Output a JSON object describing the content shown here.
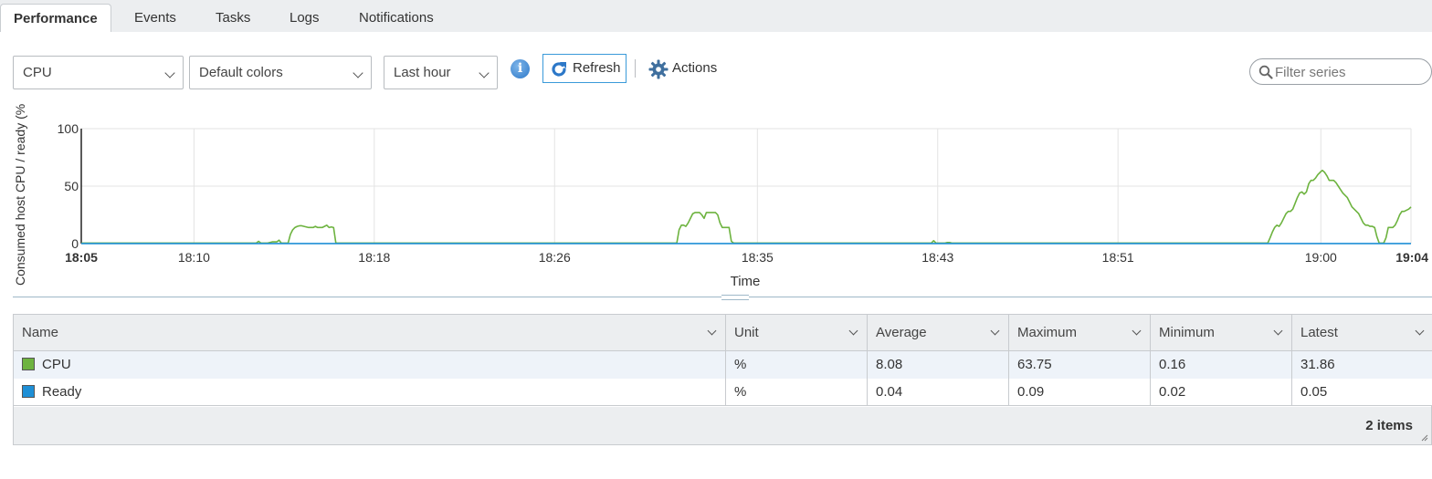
{
  "tabs": [
    {
      "label": "Performance",
      "active": true
    },
    {
      "label": "Events",
      "active": false
    },
    {
      "label": "Tasks",
      "active": false
    },
    {
      "label": "Logs",
      "active": false
    },
    {
      "label": "Notifications",
      "active": false
    }
  ],
  "toolbar": {
    "metric_select": "CPU",
    "color_select": "Default colors",
    "period_select": "Last hour",
    "info_icon": "info-icon",
    "refresh_label": "Refresh",
    "actions_label": "Actions",
    "filter_placeholder": "Filter series"
  },
  "chart_data": {
    "type": "line",
    "title": "",
    "ylabel": "Consumed host CPU / ready (%",
    "xlabel": "Time",
    "ylim": [
      0,
      100
    ],
    "yticks": [
      0,
      50,
      100
    ],
    "x_range": [
      "18:05",
      "19:04"
    ],
    "xticks": [
      {
        "label": "18:05",
        "minute": 0,
        "bold": true
      },
      {
        "label": "18:10",
        "minute": 5
      },
      {
        "label": "18:18",
        "minute": 13
      },
      {
        "label": "18:26",
        "minute": 21
      },
      {
        "label": "18:35",
        "minute": 30
      },
      {
        "label": "18:43",
        "minute": 38
      },
      {
        "label": "18:51",
        "minute": 46
      },
      {
        "label": "19:00",
        "minute": 55
      },
      {
        "label": "19:04",
        "minute": 59,
        "bold": true
      }
    ],
    "grid": true,
    "series": [
      {
        "name": "CPU",
        "color": "#6db33f",
        "values": [
          0.5,
          0.5,
          0.5,
          0.5,
          0.5,
          0.5,
          0.5,
          0.5,
          0.5,
          0.5,
          0.5,
          0.5,
          0.5,
          0.5,
          0.5,
          0.5,
          0.5,
          0.5,
          0.5,
          0.5,
          0.5,
          0.5,
          0.5,
          0.5,
          0.5,
          0.5,
          0.5,
          0.5,
          0.5,
          0.5,
          0.5,
          0.5,
          0.5,
          0.5,
          0.5,
          0.5,
          0.5,
          0.5,
          0.5,
          0.5,
          0.5,
          0.5,
          0.5,
          0.5,
          0.5,
          0.5,
          0.5,
          0.5,
          0.5,
          0.5,
          0.5,
          0.5,
          0.5,
          0.5,
          0.5,
          0.5,
          0.5,
          0.5,
          0.5,
          0.5,
          0.5,
          0.5,
          0.5,
          0.5,
          0.5,
          0.5,
          0.5,
          0.5,
          0.5,
          0.5,
          0.5,
          0.5,
          0.5,
          0.5,
          0.5,
          0.5,
          0.5,
          0.5,
          2,
          0.5,
          0.5,
          0.5,
          0.5,
          1,
          1.5,
          1.5,
          1.5,
          3,
          0.5,
          0.5,
          0.5,
          0.5,
          8,
          12,
          14,
          15,
          15.5,
          15.5,
          15,
          14.5,
          14,
          14,
          14,
          15,
          14,
          14,
          14,
          15,
          16,
          14,
          14.5,
          14,
          0.5,
          0.5,
          0.5,
          0.5,
          0.5,
          0.5,
          0.5,
          0.5,
          0.5,
          0.5,
          0.5,
          0.5,
          0.5,
          0.5,
          0.5,
          0.5,
          0.5,
          0.5,
          0.5,
          0.5,
          0.5,
          0.5,
          0.5,
          0.5,
          0.5,
          0.5,
          0.5,
          0.5,
          0.5,
          0.5,
          0.5,
          0.5,
          0.5,
          0.5,
          0.5,
          0.5,
          0.5,
          0.5,
          0.5,
          0.5,
          0.5,
          0.5,
          0.5,
          0.5,
          0.5,
          0.5,
          0.5,
          0.5,
          0.5,
          0.5,
          0.5,
          0.5,
          0.5,
          0.5,
          0.5,
          0.5,
          0.5,
          0.5,
          0.5,
          0.5,
          0.5,
          0.5,
          0.5,
          0.5,
          0.5,
          0.5,
          0.5,
          0.5,
          0.5,
          0.5,
          0.5,
          0.5,
          0.5,
          0.5,
          0.5,
          0.5,
          0.5,
          0.5,
          0.5,
          0.5,
          0.5,
          0.5,
          0.5,
          0.5,
          0.5,
          0.5,
          0.5,
          0.5,
          0.5,
          0.5,
          0.5,
          0.5,
          0.5,
          0.5,
          0.5,
          0.5,
          0.5,
          0.5,
          0.5,
          0.5,
          0.5,
          0.5,
          0.5,
          0.5,
          0.5,
          0.5,
          0.5,
          0.5,
          0.5,
          0.5,
          0.5,
          0.5,
          0.5,
          0.5,
          0.5,
          0.5,
          0.5,
          0.5,
          0.5,
          0.5,
          0.5,
          0.5,
          0.5,
          0.5,
          0.5,
          0.5,
          0.5,
          0.5,
          0.5,
          0.5,
          0.5,
          0.5,
          0.5,
          0.5,
          0.5,
          0.5,
          0.5,
          0.5,
          0.5,
          0.5,
          0.5,
          0.5,
          0.5,
          0.5,
          0.5,
          0.5,
          0.5,
          0.5,
          0.5,
          0.5,
          0.5,
          12,
          16,
          16,
          15,
          18,
          22,
          26,
          27,
          27,
          27,
          25,
          22,
          27,
          27,
          27,
          27,
          27,
          25,
          18,
          14,
          14,
          14,
          14,
          2,
          0.5,
          0.5,
          0.5,
          0.5,
          0.5,
          0.5,
          0.5,
          0.5,
          0.5,
          0.5,
          0.5,
          0.5,
          0.5,
          0.5,
          0.5,
          0.5,
          0.5,
          0.5,
          0.5,
          0.5,
          0.5,
          0.5,
          0.5,
          0.5,
          0.5,
          0.5,
          0.5,
          0.5,
          0.5,
          0.5,
          0.5,
          0.5,
          0.5,
          0.5,
          0.5,
          0.5,
          0.5,
          0.5,
          0.5,
          0.5,
          0.5,
          0.5,
          0.5,
          0.5,
          0.5,
          0.5,
          0.5,
          0.5,
          0.5,
          0.5,
          0.5,
          0.5,
          0.5,
          0.5,
          0.5,
          0.5,
          0.5,
          0.5,
          0.5,
          0.5,
          0.5,
          0.5,
          0.5,
          0.5,
          0.5,
          0.5,
          0.5,
          0.5,
          0.5,
          0.5,
          0.5,
          0.5,
          0.5,
          0.5,
          0.5,
          0.5,
          0.5,
          0.5,
          0.5,
          0.5,
          0.5,
          0.5,
          0.5,
          0.5,
          0.5,
          0.5,
          0.5,
          0.5,
          2.5,
          0.5,
          0.5,
          0.5,
          0.5,
          0.5,
          1,
          1,
          0.5,
          0.5,
          0.5,
          0.5,
          0.5,
          0.5,
          0.5,
          0.5,
          0.5,
          0.5,
          0.5,
          0.5,
          0.5,
          0.5,
          0.5,
          0.5,
          0.5,
          0.5,
          0.5,
          0.5,
          0.5,
          0.5,
          0.5,
          0.5,
          0.5,
          0.5,
          0.5,
          0.5,
          0.5,
          0.5,
          0.5,
          0.5,
          0.5,
          0.5,
          0.5,
          0.5,
          0.5,
          0.5,
          0.5,
          0.5,
          0.5,
          0.5,
          0.5,
          0.5,
          0.5,
          0.5,
          0.5,
          0.5,
          0.5,
          0.5,
          0.5,
          0.5,
          0.5,
          0.5,
          0.5,
          0.5,
          0.5,
          0.5,
          0.5,
          0.5,
          0.5,
          0.5,
          0.5,
          0.5,
          0.5,
          0.5,
          0.5,
          0.5,
          0.5,
          0.5,
          0.5,
          0.5,
          0.5,
          0.5,
          0.5,
          0.5,
          0.5,
          0.5,
          0.5,
          0.5,
          0.5,
          0.5,
          0.5,
          0.5,
          0.5,
          0.5,
          0.5,
          0.5,
          0.5,
          0.5,
          0.5,
          0.5,
          0.5,
          0.5,
          0.5,
          0.5,
          0.5,
          0.5,
          0.5,
          0.5,
          0.5,
          0.5,
          0.5,
          0.5,
          0.5,
          0.5,
          0.5,
          0.5,
          0.5,
          0.5,
          0.5,
          0.5,
          0.5,
          0.5,
          0.5,
          0.5,
          0.5,
          0.5,
          0.5,
          0.5,
          0.5,
          0.5,
          0.5,
          0.5,
          0.5,
          0.5,
          0.5,
          0.5,
          0.5,
          0.5,
          0.5,
          0.5,
          0.5,
          0.5,
          0.5,
          0.5,
          0.5,
          0.5,
          0.5,
          0.5,
          5,
          10,
          14,
          16,
          15,
          18,
          22,
          26,
          28,
          28,
          30,
          35,
          40,
          44,
          45,
          43,
          45,
          52,
          55,
          55,
          57,
          60,
          62,
          63.75,
          62,
          59,
          55,
          55,
          55,
          53,
          50,
          47,
          44,
          42,
          40,
          36,
          32,
          30,
          28,
          26,
          22,
          18,
          16,
          16,
          15,
          15,
          14,
          6,
          0.5,
          0.5,
          0.5,
          5,
          14,
          14,
          14,
          16,
          20,
          25,
          28,
          28,
          29,
          30,
          31.86
        ]
      },
      {
        "name": "Ready",
        "color": "#1e8fd6",
        "values": [
          0.05,
          0.05,
          0.05,
          0.05,
          0.05,
          0.05,
          0.05,
          0.05,
          0.05,
          0.05,
          0.05,
          0.05,
          0.05,
          0.05,
          0.05,
          0.05,
          0.05,
          0.05,
          0.05,
          0.05,
          0.05,
          0.05,
          0.05,
          0.05,
          0.05,
          0.05,
          0.05,
          0.05,
          0.05,
          0.05,
          0.05,
          0.05,
          0.05,
          0.05,
          0.05,
          0.05,
          0.05,
          0.05,
          0.05,
          0.05,
          0.05,
          0.05,
          0.05,
          0.05,
          0.05,
          0.05,
          0.05,
          0.05,
          0.05,
          0.05,
          0.05,
          0.05,
          0.05,
          0.05,
          0.05,
          0.05,
          0.05,
          0.05,
          0.05,
          0.05
        ]
      }
    ]
  },
  "table": {
    "columns": [
      "Name",
      "Unit",
      "Average",
      "Maximum",
      "Minimum",
      "Latest"
    ],
    "rows": [
      {
        "name": "CPU",
        "color": "#6db33f",
        "unit": "%",
        "average": "8.08",
        "maximum": "63.75",
        "minimum": "0.16",
        "latest": "31.86"
      },
      {
        "name": "Ready",
        "color": "#1e8fd6",
        "unit": "%",
        "average": "0.04",
        "maximum": "0.09",
        "minimum": "0.02",
        "latest": "0.05"
      }
    ],
    "footer_count": "2 items"
  }
}
